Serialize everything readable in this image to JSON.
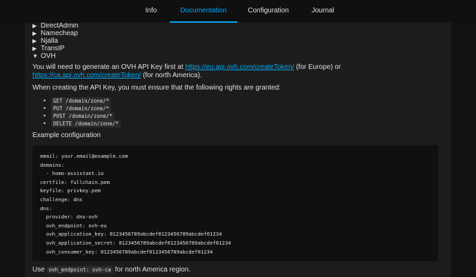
{
  "tabs": [
    {
      "label": "Info",
      "active": false
    },
    {
      "label": "Documentation",
      "active": true
    },
    {
      "label": "Configuration",
      "active": false
    },
    {
      "label": "Journal",
      "active": false
    }
  ],
  "providers": [
    {
      "label": "DirectAdmin",
      "expanded": false
    },
    {
      "label": "Namecheap",
      "expanded": false
    },
    {
      "label": "Njalla",
      "expanded": false
    },
    {
      "label": "TransIP",
      "expanded": false
    },
    {
      "label": "OVH",
      "expanded": true
    }
  ],
  "ovh": {
    "intro": {
      "before": "You will need to generate an OVH API Key first at ",
      "link_eu": "https://eu.api.ovh.com/createToken/",
      "middle": " (for Europe) or ",
      "link_ca": "https://ca.api.ovh.com/createToken/",
      "after": " (for north America)."
    },
    "rights_intro": "When creating the API Key, you must ensure that the following rights are granted:",
    "rights": [
      "GET /domain/zone/*",
      "PUT /domain/zone/*",
      "POST /domain/zone/*",
      "DELETE /domain/zone/*"
    ],
    "example_heading": "Example configuration",
    "code": "email: your.email@example.com\ndomains:\n  - home-assistant.io\ncertfile: fullchain.pem\nkeyfile: privkey.pem\nchallenge: dns\ndns:\n  provider: dns-ovh\n  ovh_endpoint: ovh-eu\n  ovh_application_key: 0123456789abcdef0123456789abcdef01234\n  ovh_application_secret: 0123456789abcdef0123456789abcdef01234\n  ovh_consumer_key: 0123456789abcdef0123456789abcdef01234",
    "footer": {
      "before": "Use ",
      "code": "ovh_endpoint: ovh-ca",
      "after": " for north America region."
    }
  },
  "colors": {
    "accent": "#03a9f4",
    "background": "#111111",
    "card": "#1c1c1c",
    "code_bg": "#101010"
  }
}
